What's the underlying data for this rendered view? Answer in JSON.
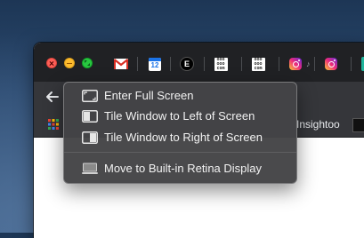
{
  "tabs": {
    "icons": [
      "gmail-icon",
      "google-calendar-icon",
      "e-icon",
      "ooo-com-icon",
      "ooo-com-icon",
      "instagram-icon",
      "instagram-icon"
    ],
    "calendar_day": "12",
    "e_letter": "E",
    "ooo_lines": [
      "ooo",
      "ooo",
      "com"
    ],
    "music_note": "♪"
  },
  "bookmarks": {
    "insightoo_label": "Insightoo"
  },
  "window_menu": {
    "items": [
      {
        "label": "Enter Full Screen",
        "icon": "enter-full-screen-icon"
      },
      {
        "label": "Tile Window to Left of Screen",
        "icon": "tile-left-icon"
      },
      {
        "label": "Tile Window to Right of Screen",
        "icon": "tile-right-icon"
      },
      {
        "label": "Move to Built-in Retina Display",
        "icon": "display-icon"
      }
    ]
  },
  "colors": {
    "close": "#fe5f57",
    "minimize": "#febc2e",
    "zoom": "#28c840",
    "menu_bg": "#444446"
  }
}
